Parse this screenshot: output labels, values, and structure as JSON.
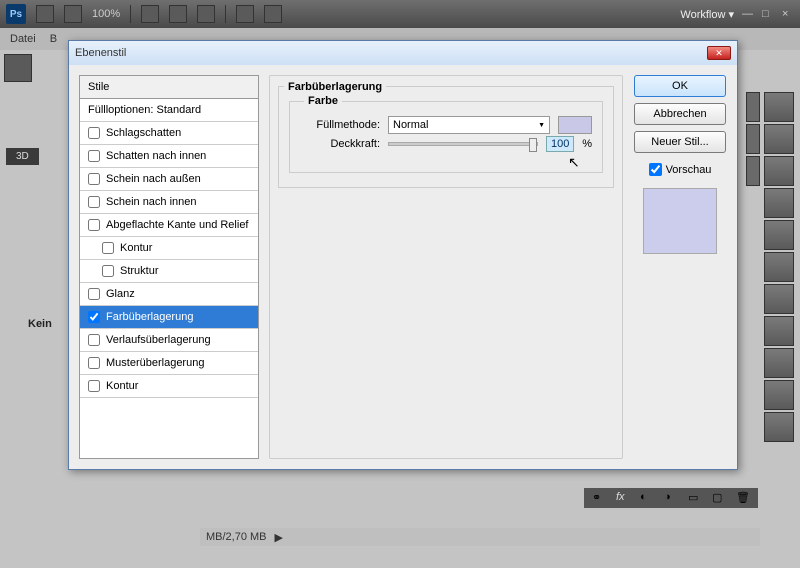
{
  "app": {
    "zoom": "100%",
    "workflow": "Workflow ▾"
  },
  "menu": {
    "file": "Datei"
  },
  "dialog": {
    "title": "Ebenenstil",
    "styles_header": "Stile",
    "blending": "Füllloptionen: Standard",
    "items": [
      {
        "label": "Schlagschatten",
        "checked": false
      },
      {
        "label": "Schatten nach innen",
        "checked": false
      },
      {
        "label": "Schein nach außen",
        "checked": false
      },
      {
        "label": "Schein nach innen",
        "checked": false
      },
      {
        "label": "Abgeflachte Kante und Relief",
        "checked": false
      },
      {
        "label": "Kontur",
        "checked": false,
        "indent": true
      },
      {
        "label": "Struktur",
        "checked": false,
        "indent": true
      },
      {
        "label": "Glanz",
        "checked": false
      },
      {
        "label": "Farbüberlagerung",
        "checked": true,
        "selected": true
      },
      {
        "label": "Verlaufsüberlagerung",
        "checked": false
      },
      {
        "label": "Musterüberlagerung",
        "checked": false
      },
      {
        "label": "Kontur",
        "checked": false
      }
    ],
    "panel": {
      "title": "Farbüberlagerung",
      "group": "Farbe",
      "blendmode_label": "Füllmethode:",
      "blendmode": "Normal",
      "opacity_label": "Deckkraft:",
      "opacity": "100",
      "pct": "%",
      "color": "#c9c8e6"
    },
    "buttons": {
      "ok": "OK",
      "cancel": "Abbrechen",
      "newstyle": "Neuer Stil...",
      "preview": "Vorschau"
    }
  },
  "doc": {
    "status": "MB/2,70 MB"
  },
  "misc": {
    "tab3d": "3D",
    "kein": "Kein"
  }
}
